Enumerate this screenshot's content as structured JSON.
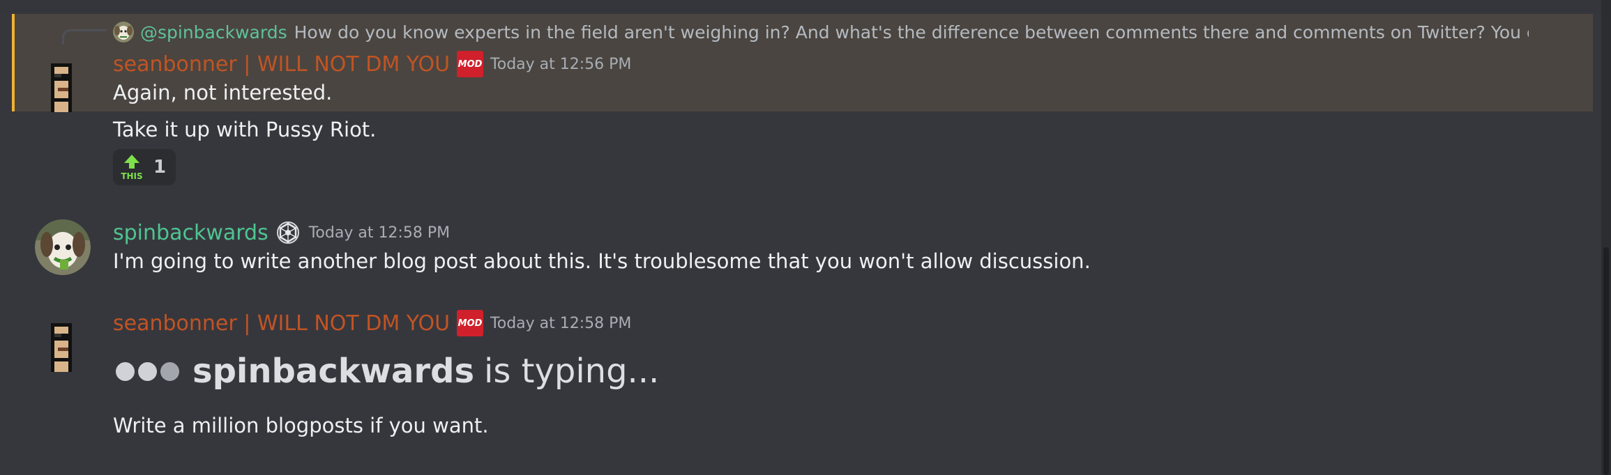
{
  "reply": {
    "author": "@spinbackwards",
    "text": "How do you know experts in the field aren't weighing in? And what's the difference between comments there and comments on Twitter? You encourage"
  },
  "messages": [
    {
      "author": "seanbonner | WILL NOT DM YOU",
      "badge": "MOD",
      "timestamp": "Today at 12:56 PM",
      "lines": [
        "Again, not interested.",
        "Take it up with Pussy Riot."
      ],
      "reaction": {
        "emoji": "this-arrow-emoji",
        "label": "THIS",
        "count": "1"
      }
    },
    {
      "author": "spinbackwards",
      "timestamp": "Today at 12:58 PM",
      "lines": [
        "I'm going to write another blog post about this. It's troublesome that you won't allow discussion."
      ]
    },
    {
      "author": "seanbonner | WILL NOT DM YOU",
      "badge": "MOD",
      "timestamp": "Today at 12:58 PM",
      "lines": [
        "Write a million blogposts if you want."
      ]
    }
  ],
  "typing": {
    "user": "spinbackwards",
    "suffix": "is typing..."
  },
  "colors": {
    "background": "#36373d",
    "highlight": "#4a4540",
    "highlight_bar": "#f0b132",
    "mod_name": "#c15424",
    "user_name": "#4fc591",
    "mod_badge": "#d0202b"
  }
}
